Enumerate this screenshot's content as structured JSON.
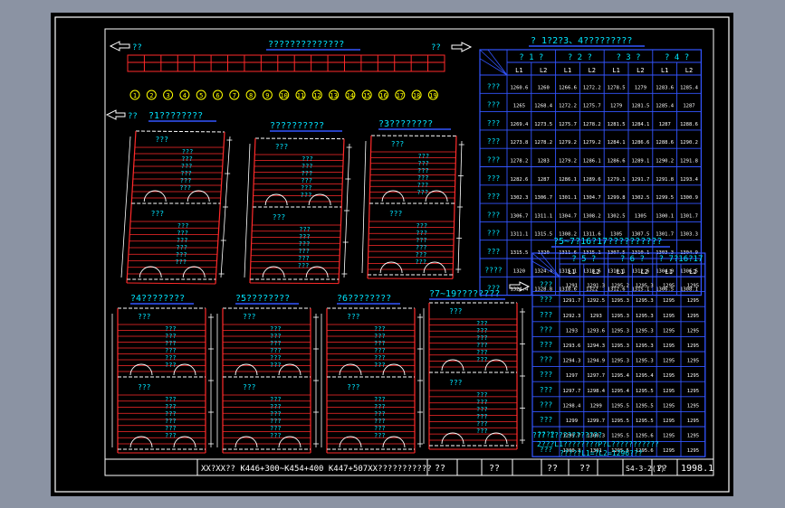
{
  "colors": {
    "bg": "#000000",
    "outer": "#8b93a3",
    "line": "#ffffff",
    "cyan": "#00e5ff",
    "red": "#ff2a2a",
    "yellow": "#ffff00",
    "blue": "#3355ff"
  },
  "top_strip": {
    "title": "??????????????",
    "left_label": "??",
    "right_label": "??",
    "numbers": [
      "1",
      "2",
      "3",
      "4",
      "5",
      "6",
      "7",
      "8",
      "9",
      "10",
      "11",
      "12",
      "13",
      "14",
      "15",
      "16",
      "17",
      "18",
      "19"
    ]
  },
  "section_arrow_label": "??",
  "panels_top": [
    {
      "title": "?1????????",
      "lines": [
        "???",
        "???",
        "???",
        "???",
        "???",
        "???",
        "??? ???"
      ]
    },
    {
      "title": "??????????",
      "lines": [
        "???",
        "???",
        "???",
        "???",
        "???",
        "???",
        "??? ???"
      ]
    },
    {
      "title": "?3????????",
      "lines": [
        "???",
        "???",
        "???",
        "???",
        "???",
        "???",
        "??? ???"
      ]
    }
  ],
  "panels_bottom": [
    {
      "title": "?4????????"
    },
    {
      "title": "?5????????"
    },
    {
      "title": "?6????????"
    },
    {
      "title": "?7~19????????"
    }
  ],
  "table1": {
    "title": "? 1?2?3、4?????????",
    "groups": [
      "? 1 ?",
      "? 2 ?",
      "? 3 ?",
      "? 4 ?"
    ],
    "subcols": [
      "L1",
      "L2",
      "L1",
      "L2",
      "L1",
      "L2",
      "L1",
      "L2"
    ],
    "rows": [
      {
        "label": "???",
        "cells": [
          "1260.6",
          "1260",
          "1266.6",
          "1272.2",
          "1278.5",
          "1279",
          "1283.6",
          "1285.4"
        ]
      },
      {
        "label": "???",
        "cells": [
          "1265",
          "1268.4",
          "1272.2",
          "1275.7",
          "1279",
          "1281.5",
          "1285.4",
          "1287"
        ]
      },
      {
        "label": "???",
        "cells": [
          "1269.4",
          "1273.5",
          "1275.7",
          "1278.2",
          "1281.5",
          "1284.1",
          "1287",
          "1288.6"
        ]
      },
      {
        "label": "???",
        "cells": [
          "1273.8",
          "1278.2",
          "1279.2",
          "1279.2",
          "1284.1",
          "1286.6",
          "1288.6",
          "1290.2"
        ]
      },
      {
        "label": "???",
        "cells": [
          "1278.2",
          "1283",
          "1279.2",
          "1286.1",
          "1286.6",
          "1289.1",
          "1290.2",
          "1291.8"
        ]
      },
      {
        "label": "???",
        "cells": [
          "1282.6",
          "1287",
          "1286.1",
          "1289.6",
          "1279.1",
          "1291.7",
          "1291.8",
          "1293.4"
        ]
      },
      {
        "label": "???",
        "cells": [
          "1302.3",
          "1306.7",
          "1301.1",
          "1304.7",
          "1299.8",
          "1302.5",
          "1299.5",
          "1300.9"
        ]
      },
      {
        "label": "???",
        "cells": [
          "1306.7",
          "1311.1",
          "1304.7",
          "1308.2",
          "1302.5",
          "1305",
          "1300.1",
          "1301.7"
        ]
      },
      {
        "label": "???",
        "cells": [
          "1311.1",
          "1315.5",
          "1308.2",
          "1311.6",
          "1305",
          "1307.5",
          "1301.7",
          "1303.3"
        ]
      },
      {
        "label": "???",
        "cells": [
          "1315.5",
          "1320",
          "1311.6",
          "1315.1",
          "1307.5",
          "1310.1",
          "1303.3",
          "1304.9"
        ]
      },
      {
        "label": "????",
        "cells": [
          "1320",
          "1324.4",
          "1315.1",
          "1318.6",
          "1310.1",
          "1312.6",
          "1304.9",
          "1306.5"
        ]
      },
      {
        "label": "???",
        "cells": [
          "1324.4",
          "1328.8",
          "1318.6",
          "1322",
          "1312.6",
          "1315.1",
          "1306.5",
          "1308.1"
        ]
      }
    ]
  },
  "table2": {
    "title": "?5~7?16?17??????????",
    "groups": [
      "? 5 ?",
      "? 6 ?",
      "? 7?16?17"
    ],
    "subcols": [
      "L1",
      "L2",
      "L1",
      "L2",
      "L1",
      "L2"
    ],
    "rows": [
      {
        "label": "???",
        "cells": [
          "1291",
          "1291.3",
          "1295.2",
          "1295.3",
          "1295",
          "1295"
        ]
      },
      {
        "label": "???",
        "cells": [
          "1291.7",
          "1292.5",
          "1295.3",
          "1295.3",
          "1295",
          "1295"
        ]
      },
      {
        "label": "???",
        "cells": [
          "1292.3",
          "1293",
          "1295.3",
          "1295.3",
          "1295",
          "1295"
        ]
      },
      {
        "label": "???",
        "cells": [
          "1293",
          "1293.6",
          "1295.3",
          "1295.3",
          "1295",
          "1295"
        ]
      },
      {
        "label": "???",
        "cells": [
          "1293.6",
          "1294.3",
          "1295.3",
          "1295.3",
          "1295",
          "1295"
        ]
      },
      {
        "label": "???",
        "cells": [
          "1294.3",
          "1294.9",
          "1295.3",
          "1295.3",
          "1295",
          "1295"
        ]
      },
      {
        "label": "???",
        "cells": [
          "1297",
          "1297.7",
          "1295.4",
          "1295.4",
          "1295",
          "1295"
        ]
      },
      {
        "label": "???",
        "cells": [
          "1297.7",
          "1298.4",
          "1295.4",
          "1295.5",
          "1295",
          "1295"
        ]
      },
      {
        "label": "???",
        "cells": [
          "1298.4",
          "1299",
          "1295.5",
          "1295.5",
          "1295",
          "1295"
        ]
      },
      {
        "label": "???",
        "cells": [
          "1299",
          "1299.7",
          "1295.5",
          "1295.5",
          "1295",
          "1295"
        ]
      },
      {
        "label": "????",
        "cells": [
          "1299.7",
          "1300.3",
          "1295.5",
          "1295.6",
          "1295",
          "1295"
        ]
      },
      {
        "label": "???",
        "cells": [
          "1300.3",
          "1301",
          "1295.5",
          "1295.6",
          "1295",
          "1295"
        ]
      }
    ]
  },
  "notes": [
    "???  1???????????",
    "2???L1????????P?L???????????",
    "?????L1=?L2=1296???"
  ],
  "title_block": {
    "description": "XX?XX??  K446+300~K454+400  K447+507XX???????????",
    "cells": [
      "??",
      "??",
      "??",
      "??",
      "??",
      "S4-3-2(1)",
      "2(1)",
      "??",
      "1998.1"
    ]
  }
}
